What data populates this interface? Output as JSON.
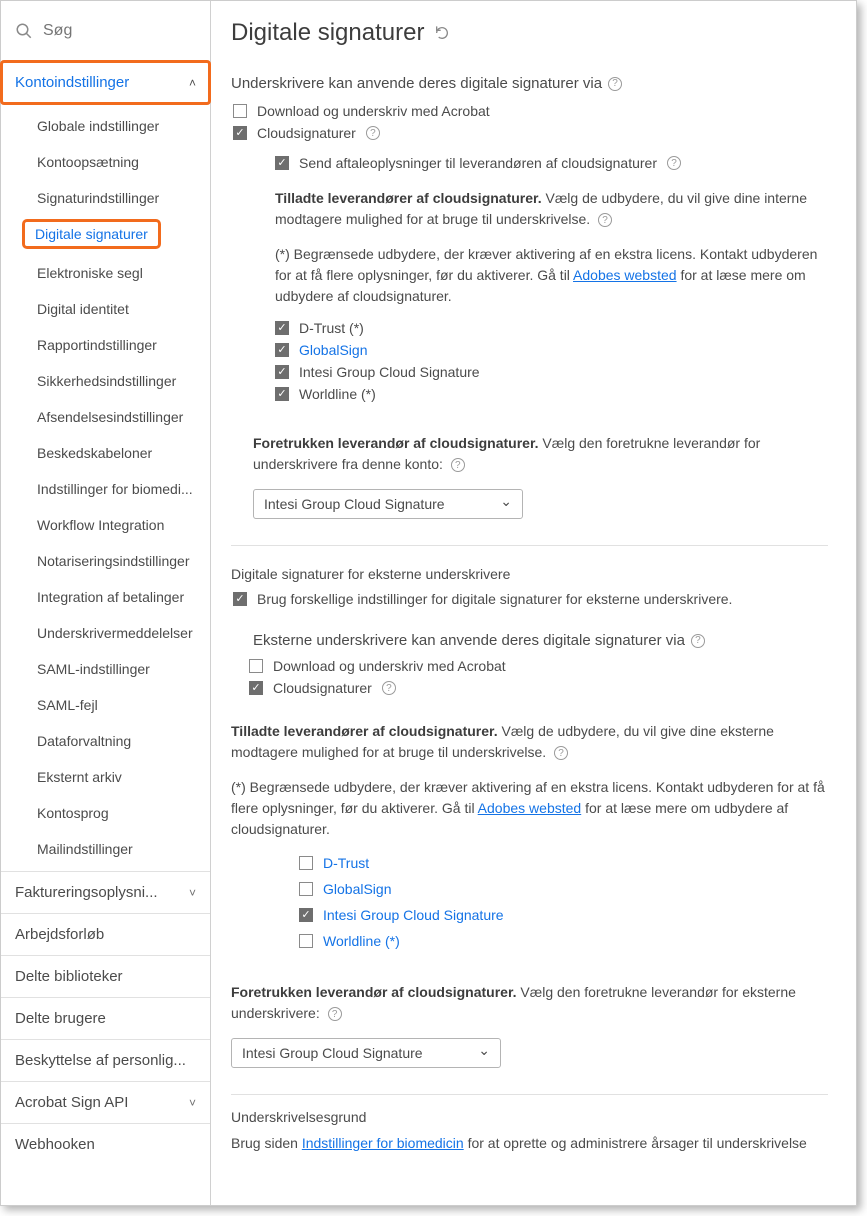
{
  "search": {
    "placeholder": "Søg"
  },
  "sidebar": {
    "expanded": {
      "label": "Kontoindstillinger",
      "items": [
        "Globale indstillinger",
        "Kontoopsætning",
        "Signaturindstillinger",
        "Digitale signaturer",
        "Elektroniske segl",
        "Digital identitet",
        "Rapportindstillinger",
        "Sikkerhedsindstillinger",
        "Afsendelsesindstillinger",
        "Beskedskabeloner",
        "Indstillinger for biomedi...",
        "Workflow Integration",
        "Notariseringsindstillinger",
        "Integration af betalinger",
        "Underskrivermeddelelser",
        "SAML-indstillinger",
        "SAML-fejl",
        "Dataforvaltning",
        "Eksternt arkiv",
        "Kontosprog",
        "Mailindstillinger"
      ],
      "active_index": 3
    },
    "groups": [
      {
        "label": "Faktureringsoplysni...",
        "chevron": true
      },
      {
        "label": "Arbejdsforløb",
        "chevron": false
      },
      {
        "label": "Delte biblioteker",
        "chevron": false
      },
      {
        "label": "Delte brugere",
        "chevron": false
      },
      {
        "label": "Beskyttelse af personlig...",
        "chevron": false
      },
      {
        "label": "Acrobat Sign API",
        "chevron": true
      },
      {
        "label": "Webhooken",
        "chevron": false
      }
    ]
  },
  "main": {
    "title": "Digitale signaturer",
    "s1": {
      "heading": "Underskrivere kan anvende deres digitale signaturer via",
      "opt_download": "Download og underskriv med Acrobat",
      "opt_cloud": "Cloudsignaturer",
      "opt_send": "Send aftaleoplysninger til leverandøren af cloudsignaturer",
      "allowed_bold": "Tilladte leverandører af cloudsignaturer.",
      "allowed_rest": "Vælg de udbydere, du vil give dine interne modtagere mulighed for at bruge til underskrivelse.",
      "note_pre": "(*) Begrænsede udbydere, der kræver aktivering af en ekstra licens. Kontakt udbyderen for at få flere oplysninger, før du aktiverer. Gå til ",
      "note_link": "Adobes websted",
      "note_post": " for at læse mere om udbydere af cloudsignaturer.",
      "providers": [
        {
          "label": "D-Trust (*)",
          "checked": true,
          "link": false
        },
        {
          "label": "GlobalSign",
          "checked": true,
          "link": true
        },
        {
          "label": "Intesi Group Cloud Signature",
          "checked": true,
          "link": false
        },
        {
          "label": "Worldline (*)",
          "checked": true,
          "link": false
        }
      ],
      "pref_bold": "Foretrukken leverandør af cloudsignaturer.",
      "pref_rest": "Vælg den foretrukne leverandør for underskrivere fra denne konto:",
      "pref_value": "Intesi Group Cloud Signature"
    },
    "s2": {
      "heading": "Digitale signaturer for eksterne underskrivere",
      "opt_diff": "Brug forskellige indstillinger for digitale signaturer for eksterne underskrivere.",
      "sub": "Eksterne underskrivere kan anvende deres digitale signaturer via",
      "opt_download": "Download og underskriv med Acrobat",
      "opt_cloud": "Cloudsignaturer",
      "allowed_bold": "Tilladte leverandører af cloudsignaturer.",
      "allowed_rest": "Vælg de udbydere, du vil give dine eksterne modtagere mulighed for at bruge til underskrivelse.",
      "note_pre": "(*) Begrænsede udbydere, der kræver aktivering af en ekstra licens. Kontakt udbyderen for at få flere oplysninger, før du aktiverer. Gå til ",
      "note_link": "Adobes websted",
      "note_post": " for at læse mere om udbydere af cloudsignaturer.",
      "providers": [
        {
          "label": "D-Trust",
          "checked": false
        },
        {
          "label": "GlobalSign",
          "checked": false
        },
        {
          "label": "Intesi Group Cloud Signature",
          "checked": true
        },
        {
          "label": "Worldline (*)",
          "checked": false
        }
      ],
      "pref_bold": "Foretrukken leverandør af cloudsignaturer.",
      "pref_rest": "Vælg den foretrukne leverandør for eksterne underskrivere:",
      "pref_value": "Intesi Group Cloud Signature"
    },
    "s3": {
      "heading": "Underskrivelsesgrund",
      "text_pre": "Brug siden ",
      "text_link": "Indstillinger for biomedicin",
      "text_post": " for at oprette og administrere årsager til underskrivelse"
    }
  }
}
